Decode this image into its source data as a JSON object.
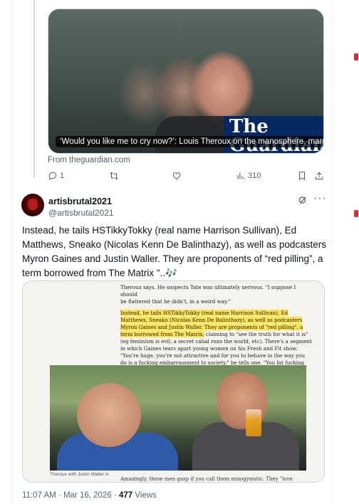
{
  "link_card": {
    "caption": "‘Would you like me to cry now?’: Louis Theroux on the manosphere, marriage a...",
    "logo_text": "The Guardian",
    "from": "From theguardian.com"
  },
  "actions": {
    "replies": "1",
    "retweets": "",
    "likes": "",
    "views": "310",
    "icons": [
      "reply-icon",
      "retweet-icon",
      "like-icon",
      "views-icon",
      "bookmark-icon",
      "share-icon"
    ]
  },
  "tweet": {
    "display_name": "artisbrutal2021",
    "handle": "@artisbrutal2021",
    "text": "Instead, he tails HSTikkyTokky (real name Harrison Sullivan), Ed Matthews, Sneako (Nicolas Kenn De Balinthazy), as well as podcasters Myron Gaines and Justin Waller. They are proponents of “red pilling”, a term borrowed from The Matrix \"..🎶"
  },
  "article": {
    "line_top_1": "Theroux says. He suspects Tate was ultimately nervous. \"I suppose I should",
    "line_top_2": "be flattered that he didn't, in a weird way.\"",
    "highlight": "Instead, he tails HSTikkyTokky (real name Harrison Sullivan), Ed Matthews, Sneako (Nicolas Kenn De Balinthazy), as well as podcasters Myron Gaines and Justin Waller. They are proponents of \"red pilling\", a term borrowed from The Matrix,",
    "rest": " claiming to \"see the truth for what it is\" (eg feminism is evil; a secret cabal runs the world, etc). There's a segment in which Gaines tears apart young women on his Fresh and Fit show. \"You're huge, you're not attractive and for you to behave in the way you do is a fucking embarrassment to society,\" he tells one. \"You fat fucking bitch, get the fuck out of my studio.\"",
    "photo_credit": "Theroux with Justin Waller in",
    "bottom": "Amazingly, these men gasp if you call them misogynistic. They \"love"
  },
  "meta": {
    "timestamp": "11:07 AM · Mar 16, 2026 · ",
    "views_count": "477",
    "views_label": " Views"
  }
}
